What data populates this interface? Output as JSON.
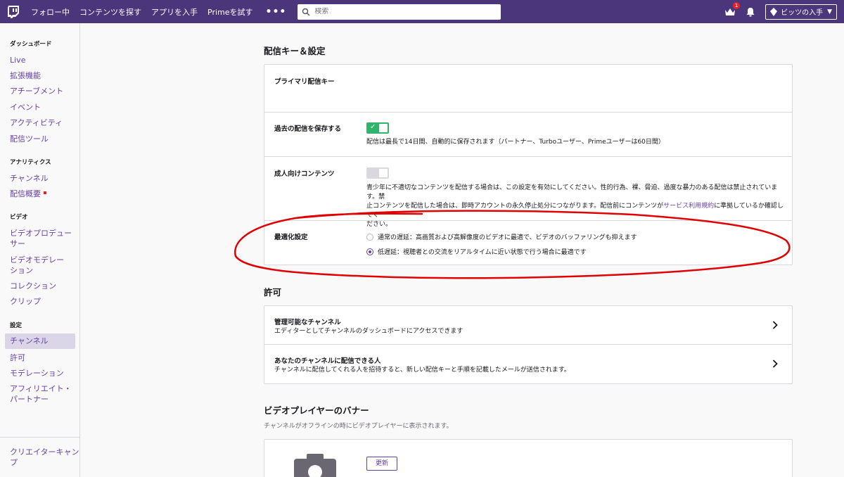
{
  "nav": {
    "links": [
      "フォロー中",
      "コンテンツを探す",
      "アプリを入手",
      "Primeを試す"
    ],
    "more": "•••",
    "search_placeholder": "検索",
    "notification_count": "1",
    "bits_label": "ビッツの入手"
  },
  "sidebar": {
    "sections": [
      {
        "title": "ダッシュボード",
        "items": [
          "Live",
          "拡張機能",
          "アチーブメント",
          "イベント",
          "アクティビティ",
          "配信ツール"
        ]
      },
      {
        "title": "アナリティクス",
        "items": [
          "チャンネル",
          "配信概要"
        ]
      },
      {
        "title": "ビデオ",
        "items": [
          "ビデオプロデュー",
          "サー",
          "ビデオモデレー",
          "ション",
          "コレクション",
          "クリップ"
        ]
      },
      {
        "title": "設定",
        "items": [
          "チャンネル",
          "許可",
          "モデレーション",
          "アフィリエイト・",
          "パートナー"
        ]
      }
    ],
    "footer": [
      "クリエイターキャン",
      "プ"
    ]
  },
  "stream_settings": {
    "title": "配信キー＆設定",
    "primary_key_label": "プライマリ配信キー",
    "save_past_label": "過去の配信を保存する",
    "save_past_desc": "配信は最長で14日間、自動的に保存されます（パートナー、Turboユーザー、Primeユーザーは60日間）",
    "save_past_on": true,
    "mature_label": "成人向けコンテンツ",
    "mature_on": false,
    "mature_desc_1": "青少年に不適切なコンテンツを配信する場合は、この設定を有効にしてください。性的行為、裸、脅迫、過度な暴力のある配信は禁止されています。禁",
    "mature_desc_2a": "止コンテンツを配信した場合は、即時アカウントの永久停止処分につながります。配信前にコンテンツが",
    "mature_desc_link": "サービス利用規約",
    "mature_desc_2b": "に準拠しているか確認してく",
    "mature_desc_3": "ださい。",
    "optimization_label": "最適化設定",
    "option_normal": "通常の遅延：高画質および高解像度のビデオに最適で、ビデオのバッファリングも抑えます",
    "option_low": "低遅延：視聴者との交流をリアルタイムに近い状態で行う場合に最適です",
    "selected_option": "low"
  },
  "permissions": {
    "title": "許可",
    "items": [
      {
        "title": "管理可能なチャンネル",
        "desc": "エディターとしてチャンネルのダッシュボードにアクセスできます"
      },
      {
        "title": "あなたのチャンネルに配信できる人",
        "desc": "チャンネルに配信してくれる人を招待すると、新しい配信キーと手順を記載したメールが送信されます。"
      }
    ]
  },
  "banner": {
    "title": "ビデオプレイヤーのバナー",
    "subtitle": "チャンネルがオフラインの時にビデオプレイヤーに表示されます。",
    "update_label": "更新"
  },
  "colors": {
    "nav_bg": "#4b367c",
    "accent": "#6441a4",
    "toggle_on": "#2fb46c",
    "annotation": "#e00000"
  }
}
